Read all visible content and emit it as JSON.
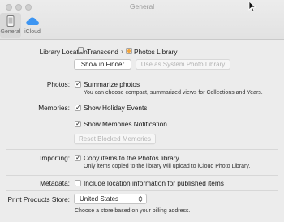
{
  "window": {
    "title": "General"
  },
  "toolbar": {
    "tabs": [
      {
        "label": "General",
        "icon": "phone-device-icon"
      },
      {
        "label": "iCloud",
        "icon": "icloud-icon"
      }
    ]
  },
  "library": {
    "label": "Library Location:",
    "path_drive": "Transcend",
    "path_separator": "›",
    "path_library": "Photos Library",
    "show_in_finder": "Show in Finder",
    "use_system": "Use as System Photo Library"
  },
  "photos": {
    "label": "Photos:",
    "summarize": "Summarize photos",
    "summarize_checked": true,
    "description": "You can choose compact, summarized views for Collections and Years."
  },
  "memories": {
    "label": "Memories:",
    "holiday": "Show Holiday Events",
    "holiday_checked": true,
    "notification": "Show Memories Notification",
    "notification_checked": true,
    "reset": "Reset Blocked Memories"
  },
  "importing": {
    "label": "Importing:",
    "copy": "Copy items to the Photos library",
    "copy_checked": true,
    "description": "Only items copied to the library will upload to iCloud Photo Library."
  },
  "metadata": {
    "label": "Metadata:",
    "include_location": "Include location information for published items",
    "include_location_checked": false
  },
  "print_store": {
    "label": "Print Products Store:",
    "selected": "United States",
    "description": "Choose a store based on your billing address."
  },
  "check_glyph": "✓",
  "colors": {
    "icloud_blue": "#3d95f2",
    "disabled_text": "#b3b3b3"
  }
}
